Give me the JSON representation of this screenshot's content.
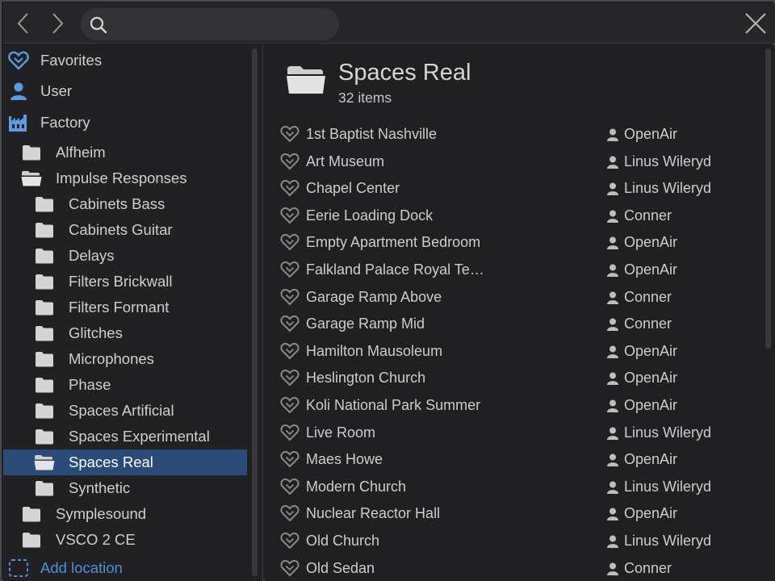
{
  "toolbar": {
    "back_icon": "chevron-left-icon",
    "forward_icon": "chevron-right-icon",
    "search_icon": "search-icon",
    "search_value": "",
    "close_icon": "close-icon"
  },
  "colors": {
    "accent": "#4d8fdc",
    "selection": "#2a4a78",
    "background": "#202022"
  },
  "sidebar": {
    "favorites": {
      "label": "Favorites",
      "icon": "heart-icon"
    },
    "user": {
      "label": "User",
      "icon": "person-icon"
    },
    "factory": {
      "label": "Factory",
      "icon": "factory-icon"
    },
    "folders": [
      {
        "label": "Alfheim",
        "level": 1,
        "open": false,
        "selected": false
      },
      {
        "label": "Impulse Responses",
        "level": 1,
        "open": true,
        "selected": false
      },
      {
        "label": "Cabinets Bass",
        "level": 2,
        "open": false,
        "selected": false
      },
      {
        "label": "Cabinets Guitar",
        "level": 2,
        "open": false,
        "selected": false
      },
      {
        "label": "Delays",
        "level": 2,
        "open": false,
        "selected": false
      },
      {
        "label": "Filters Brickwall",
        "level": 2,
        "open": false,
        "selected": false
      },
      {
        "label": "Filters Formant",
        "level": 2,
        "open": false,
        "selected": false
      },
      {
        "label": "Glitches",
        "level": 2,
        "open": false,
        "selected": false
      },
      {
        "label": "Microphones",
        "level": 2,
        "open": false,
        "selected": false
      },
      {
        "label": "Phase",
        "level": 2,
        "open": false,
        "selected": false
      },
      {
        "label": "Spaces Artificial",
        "level": 2,
        "open": false,
        "selected": false
      },
      {
        "label": "Spaces Experimental",
        "level": 2,
        "open": false,
        "selected": false
      },
      {
        "label": "Spaces Real",
        "level": 2,
        "open": true,
        "selected": true
      },
      {
        "label": "Synthetic",
        "level": 2,
        "open": false,
        "selected": false
      },
      {
        "label": "Symplesound",
        "level": 1,
        "open": false,
        "selected": false
      },
      {
        "label": "VSCO 2 CE",
        "level": 1,
        "open": false,
        "selected": false
      }
    ],
    "add_location": {
      "label": "Add location",
      "icon": "dashed-square-icon"
    }
  },
  "main": {
    "title": "Spaces Real",
    "count": "32 items",
    "items": [
      {
        "name": "1st Baptist Nashville",
        "author": "OpenAir"
      },
      {
        "name": "Art Museum",
        "author": "Linus Wileryd"
      },
      {
        "name": "Chapel Center",
        "author": "Linus Wileryd"
      },
      {
        "name": "Eerie Loading Dock",
        "author": "Conner"
      },
      {
        "name": "Empty Apartment Bedroom",
        "author": "OpenAir"
      },
      {
        "name": "Falkland Palace Royal Te…",
        "author": "OpenAir"
      },
      {
        "name": "Garage Ramp Above",
        "author": "Conner"
      },
      {
        "name": "Garage Ramp Mid",
        "author": "Conner"
      },
      {
        "name": "Hamilton Mausoleum",
        "author": "OpenAir"
      },
      {
        "name": "Heslington Church",
        "author": "OpenAir"
      },
      {
        "name": "Koli National Park Summer",
        "author": "OpenAir"
      },
      {
        "name": "Live Room",
        "author": "Linus Wileryd"
      },
      {
        "name": "Maes Howe",
        "author": "OpenAir"
      },
      {
        "name": "Modern Church",
        "author": "Linus Wileryd"
      },
      {
        "name": "Nuclear Reactor Hall",
        "author": "OpenAir"
      },
      {
        "name": "Old Church",
        "author": "Linus Wileryd"
      },
      {
        "name": "Old Sedan",
        "author": "Conner"
      }
    ]
  }
}
